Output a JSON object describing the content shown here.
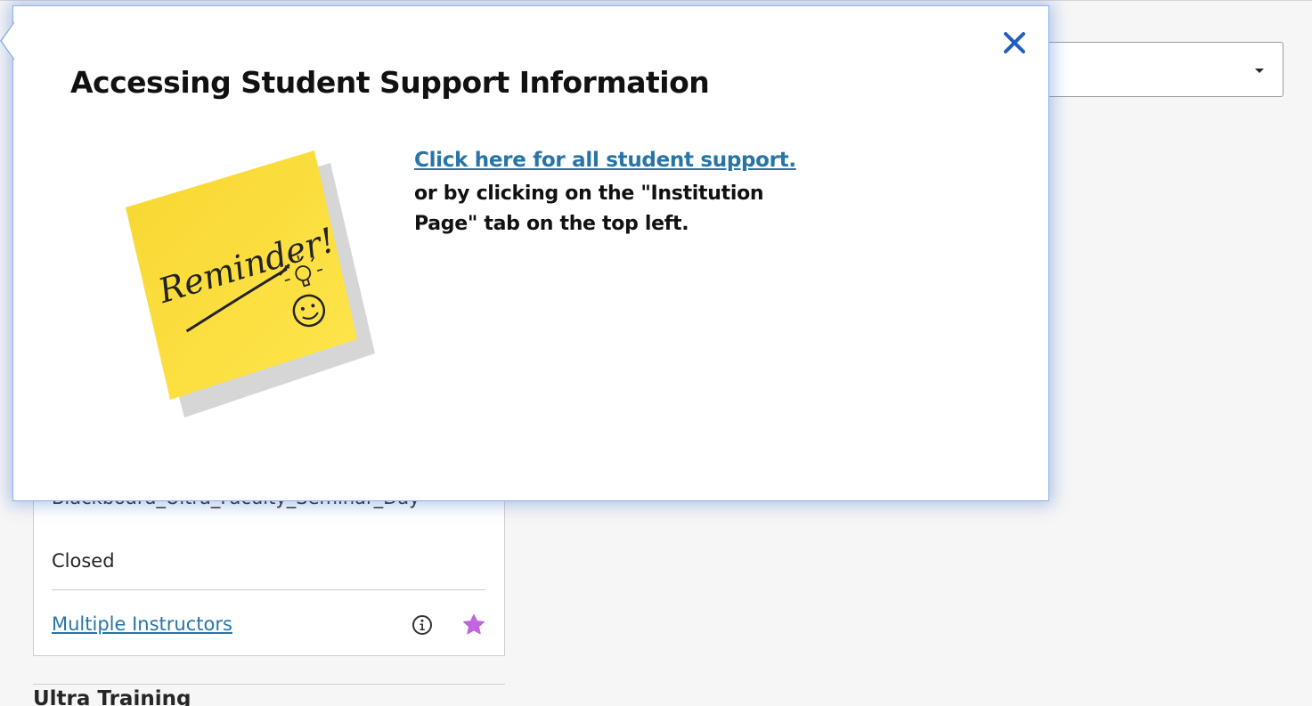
{
  "filter": {
    "selected_value": ""
  },
  "course_card": {
    "title": "Blackboard_Ultra_Faculty_Seminar_Day",
    "status": "Closed",
    "instructors_label": "Multiple Instructors",
    "favorite_color": "#c064e0"
  },
  "next_course": {
    "title": "Ultra Training"
  },
  "popover": {
    "title": "Accessing Student Support Information",
    "link_label": "Click here for all student support.",
    "body_text": "or by clicking on the \"Institution Page\" tab on the top left.",
    "note_text": "Reminder!",
    "close_icon": "close-icon",
    "accent_color": "#2874a6",
    "note_color": "#fbe043"
  }
}
